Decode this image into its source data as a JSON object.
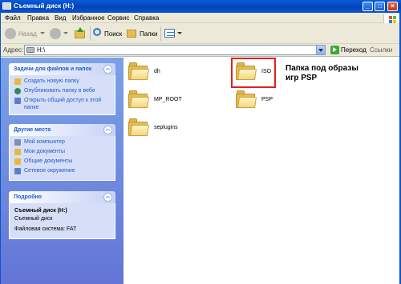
{
  "window": {
    "title": "Съемный диск (H:)",
    "buttons": {
      "minimize": "_",
      "maximize": "□",
      "close": "×"
    }
  },
  "menu": [
    "Файл",
    "Правка",
    "Вид",
    "Избранное",
    "Сервис",
    "Справка"
  ],
  "toolbar": {
    "back_label": "Назад",
    "search_label": "Поиск",
    "folders_label": "Папки"
  },
  "address": {
    "label": "Адрес:",
    "value": "H:\\",
    "go_label": "Переход",
    "links_label": "Ссылки"
  },
  "left": {
    "tasks": {
      "title": "Задачи для файлов и папок",
      "items": [
        {
          "label": "Создать новую папку",
          "icon": "new-folder-icon",
          "color": "#e8b93a"
        },
        {
          "label": "Опубликовать папку в вебе",
          "icon": "globe-icon",
          "color": "#2e8b57"
        },
        {
          "label": "Открыть общий доступ к этой папке",
          "icon": "share-icon",
          "color": "#5a7fc7"
        }
      ]
    },
    "places": {
      "title": "Другие места",
      "items": [
        {
          "label": "Мой компьютер",
          "icon": "computer-icon",
          "color": "#7f8fb0"
        },
        {
          "label": "Мои документы",
          "icon": "documents-icon",
          "color": "#e8b93a"
        },
        {
          "label": "Общие документы",
          "icon": "shared-documents-icon",
          "color": "#e8b93a"
        },
        {
          "label": "Сетевое окружение",
          "icon": "network-icon",
          "color": "#5a7fc7"
        }
      ]
    },
    "details": {
      "title": "Подробно",
      "name": "Съемный диск (H:)",
      "type": "Съемный диск",
      "fs": "Файловая система: FAT"
    }
  },
  "files": [
    {
      "name": "dh"
    },
    {
      "name": "ISO"
    },
    {
      "name": "MP_ROOT"
    },
    {
      "name": "PSP"
    },
    {
      "name": "seplugins"
    }
  ],
  "annotation": {
    "line1": "Папка под образы",
    "line2": "игр PSP",
    "color": "#e02020"
  }
}
